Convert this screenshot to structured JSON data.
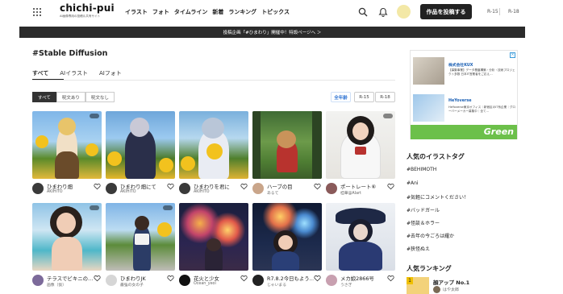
{
  "header": {
    "logo_name": "chichi-pui",
    "logo_tagline": "AI画像専用の投稿＆共有サイト",
    "nav": [
      "イラスト",
      "フォト",
      "タイムライン",
      "新着",
      "ランキング",
      "トピックス"
    ],
    "post_button": "作品を投稿する",
    "rating_r15": "R-15",
    "rating_r18": "R-18"
  },
  "banner": "投稿企画「#ひまわり」開催中！特設ページへ ＞",
  "page_title": "#Stable Diffusion",
  "tabs": [
    "すべて",
    "AIイラスト",
    "AIフォト"
  ],
  "filters": [
    "すべて",
    "呪文あり",
    "呪文なし"
  ],
  "sort_options": [
    "全年齢",
    "R-15",
    "R-18"
  ],
  "cards": [
    {
      "title": "ひまわり畑",
      "author": "AKIHITO"
    },
    {
      "title": "ひまわり畑にて",
      "author": "AKIHITO"
    },
    {
      "title": "ひまわりを君に",
      "author": "AKIHITO"
    },
    {
      "title": "ハーブの目",
      "author": "あるて"
    },
    {
      "title": "ポートレート⑥",
      "author": "桂華@AIart"
    },
    {
      "title": "テラスでビキニの…",
      "author": "画像（仮）"
    },
    {
      "title": "ひまわりJK",
      "author": "最強の女の子"
    },
    {
      "title": "花火と少女",
      "author": "Ocean_yeoi"
    },
    {
      "title": "R7.8.2今日もよう…",
      "author": "じゃいまる"
    },
    {
      "title": "メカ娘2866号",
      "author": "うさぎ"
    }
  ],
  "ad": {
    "company": "株式会社KUX",
    "text1": "【募集事業】データ基盤構築・分析・技術プロジェクト多数 日本IT営業者をご応え…",
    "brand": "HeYoverse",
    "text2": "HeYoverse東京オフィス｜新宿区のIT系企業｜グローバーメーカー募集中｜全て…",
    "green_logo": "Green"
  },
  "sidebar": {
    "tags_heading": "人気のイラストタグ",
    "tags": [
      "#BEHIMOTH",
      "#Ani",
      "#気軽にコメントください！",
      "#バッドガール",
      "#怪談＆ホラー",
      "#去年の今ごろは耀か",
      "#狭怪ぬえ"
    ],
    "ranking_heading": "人気ランキング",
    "ranking_item": {
      "rank": "1",
      "title": "顔アップ No.1",
      "author": "はや太郎"
    }
  }
}
